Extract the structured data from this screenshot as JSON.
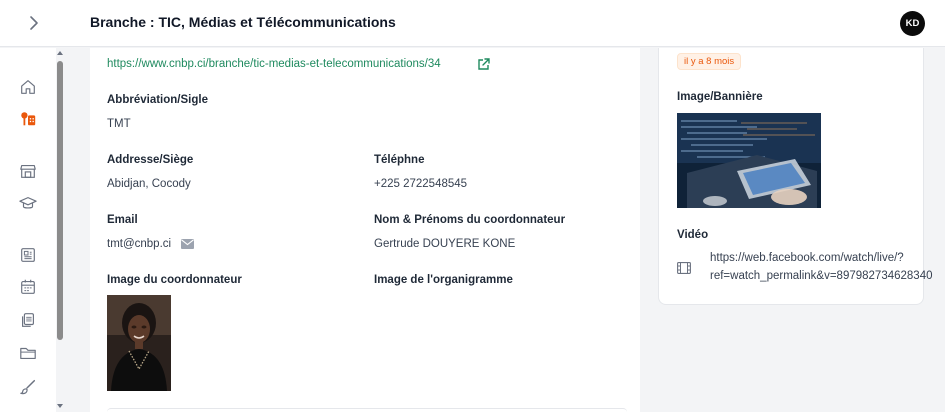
{
  "header": {
    "title": "Branche : TIC, Médias et Télécommunications",
    "avatar_initials": "KD"
  },
  "sidebar": {
    "items": [
      {
        "icon": "home-icon",
        "active": false
      },
      {
        "icon": "branches-icon",
        "active": true
      },
      {
        "icon": "store-icon",
        "active": false
      },
      {
        "icon": "graduation-cap-icon",
        "active": false
      },
      {
        "icon": "news-icon",
        "active": false
      },
      {
        "icon": "calendar-icon",
        "active": false
      },
      {
        "icon": "copy-icon",
        "active": false
      },
      {
        "icon": "folder-icon",
        "active": false
      },
      {
        "icon": "brush-icon",
        "active": false
      }
    ]
  },
  "main": {
    "url": "https://www.cnbp.ci/branche/tic-medias-et-telecommunications/34",
    "abbr_label": "Abbréviation/Sigle",
    "abbr_value": "TMT",
    "address_label": "Addresse/Siège",
    "address_value": "Abidjan, Cocody",
    "phone_label": "Téléphne",
    "phone_value": "+225 2722548545",
    "email_label": "Email",
    "email_value": "tmt@cnbp.ci",
    "coordinator_label": "Nom & Prénoms du coordonnateur",
    "coordinator_value": "Gertrude DOUYERE KONE",
    "coordinator_image_label": "Image du coordonnateur",
    "org_image_label": "Image de l'organigramme"
  },
  "right": {
    "badge": "il y a 8 mois",
    "banner_label": "Image/Bannière",
    "video_label": "Vidéo",
    "video_url_line1": "https://web.facebook.com/watch/live/?",
    "video_url_line2": "ref=watch_permalink&v=897982734628340"
  },
  "colors": {
    "accent_green": "#1f8a5f",
    "active_orange": "#ea580c",
    "badge_bg": "#fff1e6"
  }
}
